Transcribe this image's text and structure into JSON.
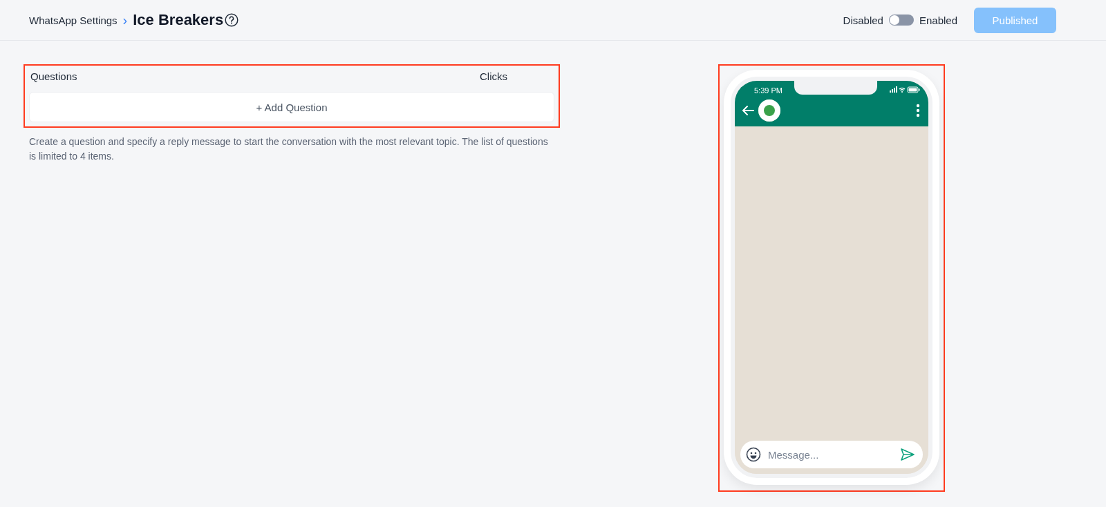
{
  "breadcrumb": {
    "parent": "WhatsApp Settings",
    "separator": "›",
    "title": "Ice Breakers"
  },
  "status_toggle": {
    "off_label": "Disabled",
    "on_label": "Enabled",
    "on": false
  },
  "publish_button": {
    "label": "Published",
    "disabled": true
  },
  "questions_table": {
    "columns": [
      "Questions",
      "Clicks"
    ],
    "add_button": "+ Add Question",
    "highlighted": true
  },
  "help_text": "Create a question and specify a reply message to start the conversation with the most relevant topic. The list of questions is limited to 4 items.",
  "phone_preview": {
    "time": "5:39 PM",
    "message_placeholder": "Message...",
    "highlighted": true
  }
}
